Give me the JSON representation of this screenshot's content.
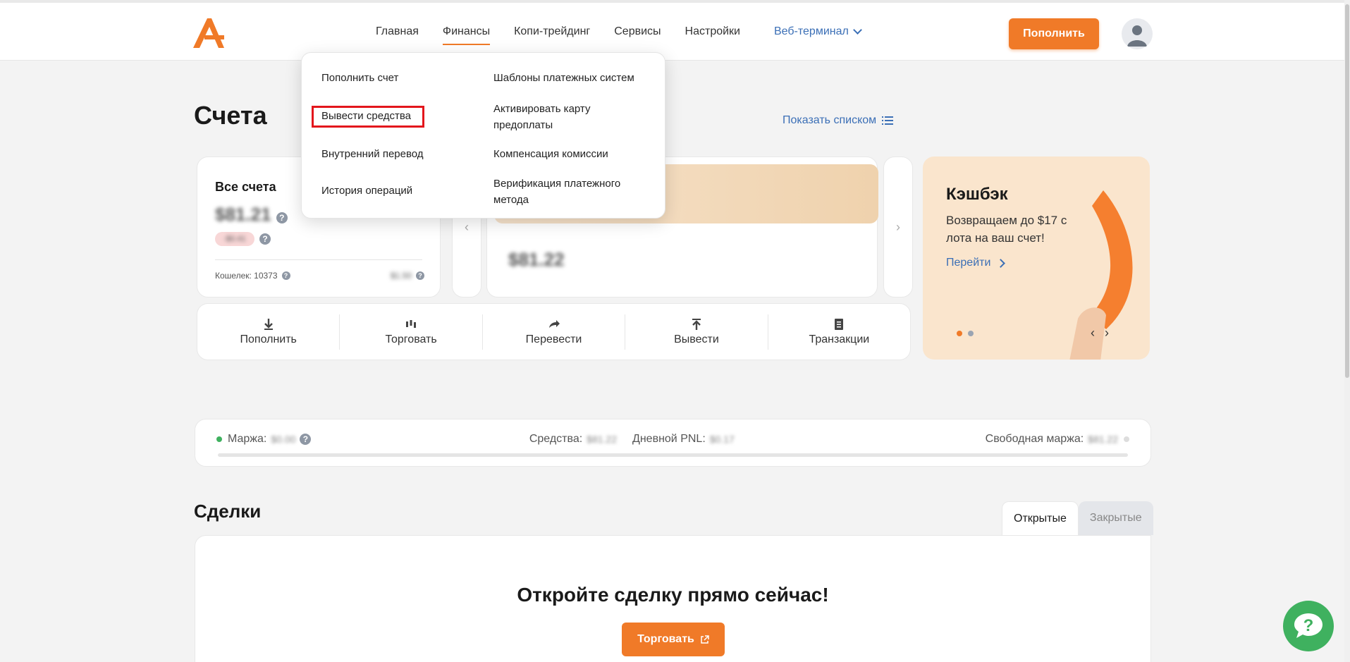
{
  "header": {
    "nav": [
      "Главная",
      "Финансы",
      "Копи-трейдинг",
      "Сервисы",
      "Настройки"
    ],
    "terminal": "Веб-терминал",
    "topup": "Пополнить"
  },
  "dropdown": {
    "left": [
      "Пополнить счет",
      "Вывести средства",
      "Внутренний перевод",
      "История операций"
    ],
    "right": [
      "Шаблоны платежных систем",
      "Активировать карту предоплаты",
      "Компенсация комиссии",
      "Верификация платежного метода"
    ]
  },
  "accounts": {
    "title": "Счета",
    "show_list": "Показать списком",
    "all_title": "Все счета",
    "all_amount": "$81.21",
    "pill": "-$0.41",
    "wallet": "Кошелек: 10373",
    "wallet_value": "$1.50",
    "account_amount": "$81.22"
  },
  "cashback": {
    "title": "Кэшбэк",
    "desc": "Возвращаем до $17 с лота на ваш счет!",
    "link": "Перейти"
  },
  "actions": [
    "Пополнить",
    "Торговать",
    "Перевести",
    "Вывести",
    "Транзакции"
  ],
  "margin": {
    "margin_label": "Маржа:",
    "margin_val": "$0.00",
    "equity_label": "Средства:",
    "equity_val": "$81.22",
    "pnl_label": "Дневной PNL:",
    "pnl_val": "$0.17",
    "free_label": "Свободная маржа:",
    "free_val": "$81.22"
  },
  "deals": {
    "title": "Сделки",
    "tab_open": "Открытые",
    "tab_closed": "Закрытые",
    "cta": "Откройте сделку прямо сейчас!",
    "trade_btn": "Торговать"
  }
}
